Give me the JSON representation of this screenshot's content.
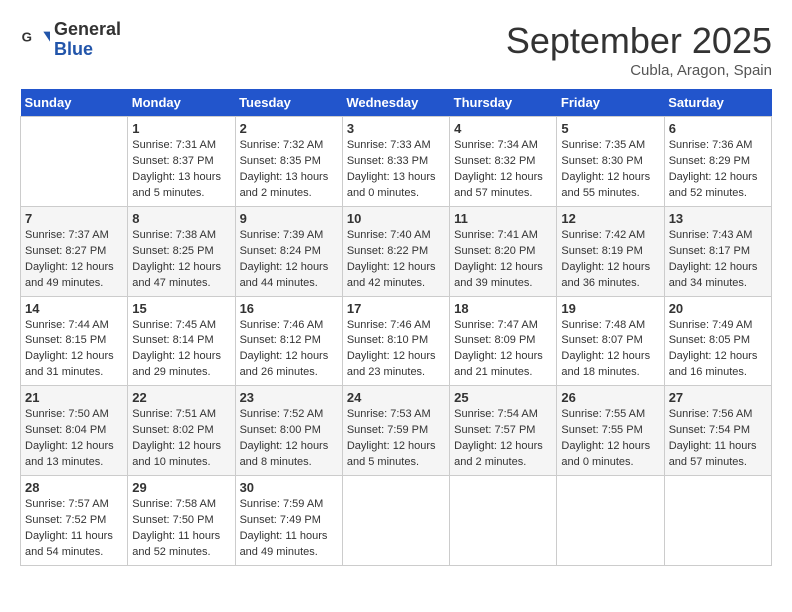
{
  "header": {
    "logo_general": "General",
    "logo_blue": "Blue",
    "month_title": "September 2025",
    "location": "Cubla, Aragon, Spain"
  },
  "days_of_week": [
    "Sunday",
    "Monday",
    "Tuesday",
    "Wednesday",
    "Thursday",
    "Friday",
    "Saturday"
  ],
  "weeks": [
    [
      {
        "day": "",
        "info": ""
      },
      {
        "day": "1",
        "info": "Sunrise: 7:31 AM\nSunset: 8:37 PM\nDaylight: 13 hours\nand 5 minutes."
      },
      {
        "day": "2",
        "info": "Sunrise: 7:32 AM\nSunset: 8:35 PM\nDaylight: 13 hours\nand 2 minutes."
      },
      {
        "day": "3",
        "info": "Sunrise: 7:33 AM\nSunset: 8:33 PM\nDaylight: 13 hours\nand 0 minutes."
      },
      {
        "day": "4",
        "info": "Sunrise: 7:34 AM\nSunset: 8:32 PM\nDaylight: 12 hours\nand 57 minutes."
      },
      {
        "day": "5",
        "info": "Sunrise: 7:35 AM\nSunset: 8:30 PM\nDaylight: 12 hours\nand 55 minutes."
      },
      {
        "day": "6",
        "info": "Sunrise: 7:36 AM\nSunset: 8:29 PM\nDaylight: 12 hours\nand 52 minutes."
      }
    ],
    [
      {
        "day": "7",
        "info": "Sunrise: 7:37 AM\nSunset: 8:27 PM\nDaylight: 12 hours\nand 49 minutes."
      },
      {
        "day": "8",
        "info": "Sunrise: 7:38 AM\nSunset: 8:25 PM\nDaylight: 12 hours\nand 47 minutes."
      },
      {
        "day": "9",
        "info": "Sunrise: 7:39 AM\nSunset: 8:24 PM\nDaylight: 12 hours\nand 44 minutes."
      },
      {
        "day": "10",
        "info": "Sunrise: 7:40 AM\nSunset: 8:22 PM\nDaylight: 12 hours\nand 42 minutes."
      },
      {
        "day": "11",
        "info": "Sunrise: 7:41 AM\nSunset: 8:20 PM\nDaylight: 12 hours\nand 39 minutes."
      },
      {
        "day": "12",
        "info": "Sunrise: 7:42 AM\nSunset: 8:19 PM\nDaylight: 12 hours\nand 36 minutes."
      },
      {
        "day": "13",
        "info": "Sunrise: 7:43 AM\nSunset: 8:17 PM\nDaylight: 12 hours\nand 34 minutes."
      }
    ],
    [
      {
        "day": "14",
        "info": "Sunrise: 7:44 AM\nSunset: 8:15 PM\nDaylight: 12 hours\nand 31 minutes."
      },
      {
        "day": "15",
        "info": "Sunrise: 7:45 AM\nSunset: 8:14 PM\nDaylight: 12 hours\nand 29 minutes."
      },
      {
        "day": "16",
        "info": "Sunrise: 7:46 AM\nSunset: 8:12 PM\nDaylight: 12 hours\nand 26 minutes."
      },
      {
        "day": "17",
        "info": "Sunrise: 7:46 AM\nSunset: 8:10 PM\nDaylight: 12 hours\nand 23 minutes."
      },
      {
        "day": "18",
        "info": "Sunrise: 7:47 AM\nSunset: 8:09 PM\nDaylight: 12 hours\nand 21 minutes."
      },
      {
        "day": "19",
        "info": "Sunrise: 7:48 AM\nSunset: 8:07 PM\nDaylight: 12 hours\nand 18 minutes."
      },
      {
        "day": "20",
        "info": "Sunrise: 7:49 AM\nSunset: 8:05 PM\nDaylight: 12 hours\nand 16 minutes."
      }
    ],
    [
      {
        "day": "21",
        "info": "Sunrise: 7:50 AM\nSunset: 8:04 PM\nDaylight: 12 hours\nand 13 minutes."
      },
      {
        "day": "22",
        "info": "Sunrise: 7:51 AM\nSunset: 8:02 PM\nDaylight: 12 hours\nand 10 minutes."
      },
      {
        "day": "23",
        "info": "Sunrise: 7:52 AM\nSunset: 8:00 PM\nDaylight: 12 hours\nand 8 minutes."
      },
      {
        "day": "24",
        "info": "Sunrise: 7:53 AM\nSunset: 7:59 PM\nDaylight: 12 hours\nand 5 minutes."
      },
      {
        "day": "25",
        "info": "Sunrise: 7:54 AM\nSunset: 7:57 PM\nDaylight: 12 hours\nand 2 minutes."
      },
      {
        "day": "26",
        "info": "Sunrise: 7:55 AM\nSunset: 7:55 PM\nDaylight: 12 hours\nand 0 minutes."
      },
      {
        "day": "27",
        "info": "Sunrise: 7:56 AM\nSunset: 7:54 PM\nDaylight: 11 hours\nand 57 minutes."
      }
    ],
    [
      {
        "day": "28",
        "info": "Sunrise: 7:57 AM\nSunset: 7:52 PM\nDaylight: 11 hours\nand 54 minutes."
      },
      {
        "day": "29",
        "info": "Sunrise: 7:58 AM\nSunset: 7:50 PM\nDaylight: 11 hours\nand 52 minutes."
      },
      {
        "day": "30",
        "info": "Sunrise: 7:59 AM\nSunset: 7:49 PM\nDaylight: 11 hours\nand 49 minutes."
      },
      {
        "day": "",
        "info": ""
      },
      {
        "day": "",
        "info": ""
      },
      {
        "day": "",
        "info": ""
      },
      {
        "day": "",
        "info": ""
      }
    ]
  ]
}
